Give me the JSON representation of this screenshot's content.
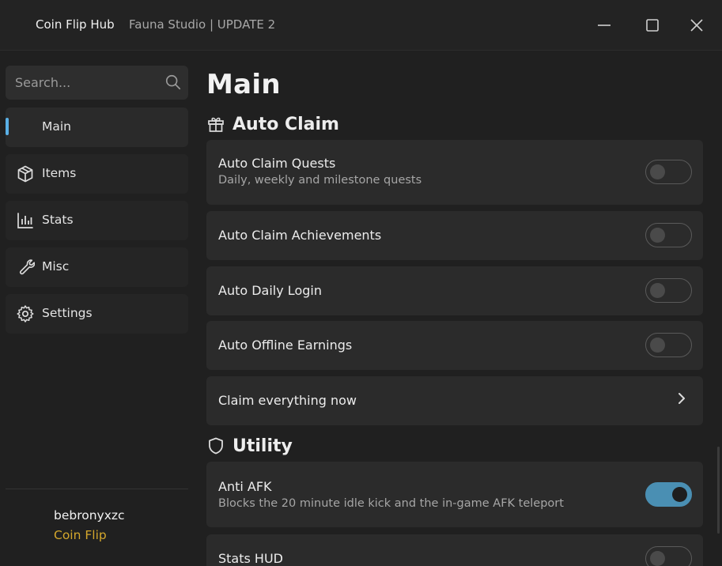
{
  "window": {
    "title": "Coin Flip Hub",
    "subtitle": "Fauna Studio | UPDATE 2"
  },
  "sidebar": {
    "search_placeholder": "Search...",
    "items": [
      {
        "label": "Main",
        "icon": "none",
        "active": true
      },
      {
        "label": "Items",
        "icon": "box-icon"
      },
      {
        "label": "Stats",
        "icon": "bar-chart-icon"
      },
      {
        "label": "Misc",
        "icon": "wrench-icon"
      },
      {
        "label": "Settings",
        "icon": "gear-icon"
      }
    ],
    "user": {
      "name": "bebronyxzc",
      "role": "Coin Flip"
    }
  },
  "main": {
    "title": "Main",
    "sections": [
      {
        "title": "Auto Claim",
        "icon": "gift-icon",
        "items": [
          {
            "title": "Auto Claim Quests",
            "description": "Daily, weekly and milestone quests",
            "toggle": false
          },
          {
            "title": "Auto Claim Achievements",
            "toggle": false
          },
          {
            "title": "Auto Daily Login",
            "toggle": false
          },
          {
            "title": "Auto Offline Earnings",
            "toggle": false
          },
          {
            "title": "Claim everything now",
            "control": "chevron-right-icon"
          }
        ]
      },
      {
        "title": "Utility",
        "icon": "shield-icon",
        "items": [
          {
            "title": "Anti AFK",
            "description": "Blocks the 20 minute idle kick and the in-game AFK teleport",
            "toggle": true
          },
          {
            "title": "Stats HUD",
            "toggle": false
          }
        ]
      }
    ]
  },
  "colors": {
    "accent": "#5ab0e6",
    "toggle_on": "#4a8fb3",
    "user_role": "#d4a72c"
  }
}
